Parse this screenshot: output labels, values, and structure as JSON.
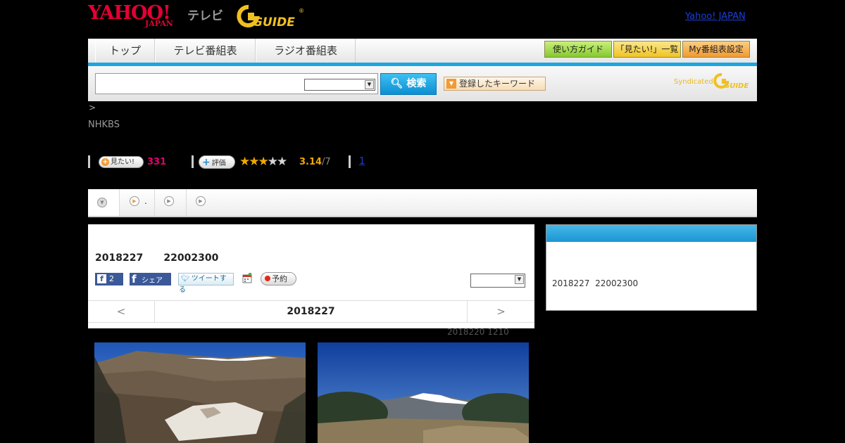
{
  "header": {
    "yahoo_logo": "YAHOO!",
    "japan_logo": "JAPAN",
    "tv_label": "テレビ",
    "gguide_logo": "G GUIDE",
    "yahoo_japan_link": "Yahoo! JAPAN"
  },
  "nav": {
    "tabs": [
      {
        "label": "トップ"
      },
      {
        "label": "テレビ番組表"
      },
      {
        "label": "ラジオ番組表"
      }
    ],
    "buttons": [
      {
        "label": "使い方ガイド",
        "color": "#9fd84a"
      },
      {
        "label": "「見たい!」一覧",
        "color": "#f5d03a"
      },
      {
        "label": "My番組表設定",
        "color": "#f5a53a"
      }
    ]
  },
  "search": {
    "placeholder": "",
    "select_value": "",
    "button_label": "検索",
    "keyword_button_label": "登録したキーワード",
    "syndicated_label": "Syndicated"
  },
  "breadcrumb": ">",
  "channel": "NHKBS",
  "stats": {
    "want_label": "見たい!",
    "want_count": "331",
    "rate_label": "評価",
    "rating": 3.14,
    "rating_value": "3.14",
    "rating_count": "/7",
    "review_link": "1"
  },
  "tabs": [
    {
      "label": ""
    },
    {
      "label": "."
    },
    {
      "label": ""
    },
    {
      "label": ""
    }
  ],
  "program": {
    "broadcast_time": "2018227      22002300",
    "fb_like_count": "2",
    "fb_share_label": "シェア",
    "tweet_label": "ツイートする",
    "reserve_label": "予約",
    "select_value": "",
    "prev_day": "<",
    "date": "2018227",
    "next_day": ">",
    "updated": "2018220  1210"
  },
  "sidebar": {
    "header": "",
    "time": "2018227  22002300"
  },
  "colors": {
    "accent_blue": "#1ba6e0",
    "yahoo_red": "#e60033",
    "star": "#f0a800",
    "want_pink": "#e6006e"
  }
}
